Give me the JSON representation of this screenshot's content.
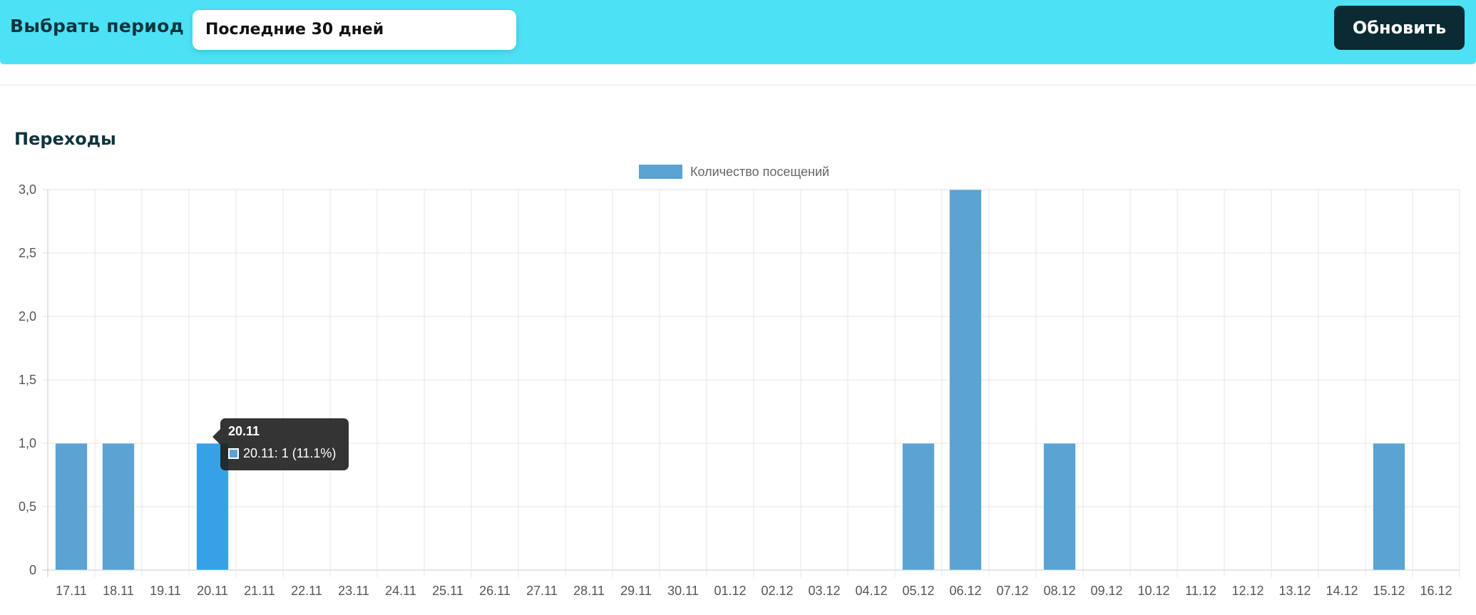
{
  "header": {
    "period_label": "Выбрать период",
    "period_value": "Последние 30 дней",
    "refresh_label": "Обновить"
  },
  "section": {
    "title": "Переходы"
  },
  "tooltip": {
    "title": "20.11",
    "line": "20.11: 1 (11.1%)"
  },
  "colors": {
    "accent_bar": "#4de1f5",
    "button_bg": "#0b2a33",
    "bar": "#5aa3d3",
    "bar_hover": "#36a2e5"
  },
  "chart_data": {
    "type": "bar",
    "title": "",
    "legend": {
      "position": "top-center"
    },
    "grid": true,
    "categories": [
      "17.11",
      "18.11",
      "19.11",
      "20.11",
      "21.11",
      "22.11",
      "23.11",
      "24.11",
      "25.11",
      "26.11",
      "27.11",
      "28.11",
      "29.11",
      "30.11",
      "01.12",
      "02.12",
      "03.12",
      "04.12",
      "05.12",
      "06.12",
      "07.12",
      "08.12",
      "09.12",
      "10.12",
      "11.12",
      "12.12",
      "13.12",
      "14.12",
      "15.12",
      "16.12"
    ],
    "series": [
      {
        "name": "Количество посещений",
        "values": [
          1,
          1,
          0,
          1,
          0,
          0,
          0,
          0,
          0,
          0,
          0,
          0,
          0,
          0,
          0,
          0,
          0,
          0,
          1,
          3,
          0,
          1,
          0,
          0,
          0,
          0,
          0,
          0,
          1,
          0
        ]
      }
    ],
    "ylim": [
      0,
      3
    ],
    "yticks": [
      "0",
      "0,5",
      "1,0",
      "1,5",
      "2,0",
      "2,5",
      "3,0"
    ],
    "highlighted_category": "20.11"
  }
}
